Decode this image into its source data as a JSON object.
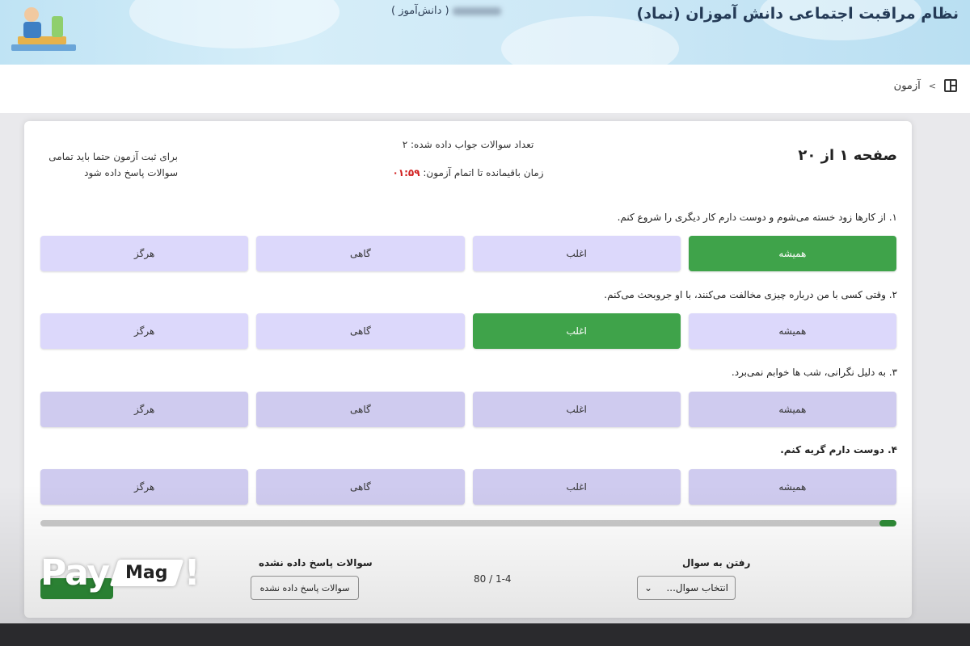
{
  "header": {
    "title": "نظام مراقبت اجتماعی دانش آموزان (نماد)",
    "user_role": "( دانش‌آموز )"
  },
  "breadcrumb": {
    "current": "آزمون",
    "separator": ">"
  },
  "exam": {
    "page_title": "صفحه ۱ از ۲۰",
    "answered_count": "تعداد سوالات جواب داده شده: ۲",
    "remaining_time_label": "زمان باقیمانده تا اتمام آزمون:",
    "remaining_time_value": "۰۱:۵۹",
    "notice": "برای ثبت آزمون حتما باید تمامی سوالات پاسخ داده شود",
    "questions": [
      {
        "text": "۱. از کارها زود خسته می‌شوم و دوست دارم کار دیگری را شروع کنم.",
        "options": [
          "همیشه",
          "اغلب",
          "گاهی",
          "هرگز"
        ],
        "selected": 0
      },
      {
        "text": "۲. وقتی کسی با من درباره چیزی مخالفت می‌کنند، با او جروبحث می‌کنم.",
        "options": [
          "همیشه",
          "اغلب",
          "گاهی",
          "هرگز"
        ],
        "selected": 1
      },
      {
        "text": "۳. به دلیل نگرانی، شب ها خوابم نمی‌برد.",
        "options": [
          "همیشه",
          "اغلب",
          "گاهی",
          "هرگز"
        ],
        "selected": -1
      },
      {
        "text": "۴. دوست دارم گریه کنم.",
        "options": [
          "همیشه",
          "اغلب",
          "گاهی",
          "هرگز"
        ],
        "selected": -1
      }
    ],
    "progress_fraction": 0.02
  },
  "footer": {
    "goto_label": "رفتن به سوال",
    "goto_select_value": "انتخاب سوال...",
    "page_range": "80 / 1-4",
    "unanswered_label": "سوالات پاسخ داده نشده",
    "unanswered_button": "سوالات پاسخ داده نشده"
  },
  "watermark": {
    "pay": "Pay",
    "mag": "Mag",
    "bang": "!"
  },
  "colors": {
    "selected": "#3fa34a",
    "option": "#dcd8fb",
    "timer": "#d12020",
    "progress": "#2e8b37"
  }
}
